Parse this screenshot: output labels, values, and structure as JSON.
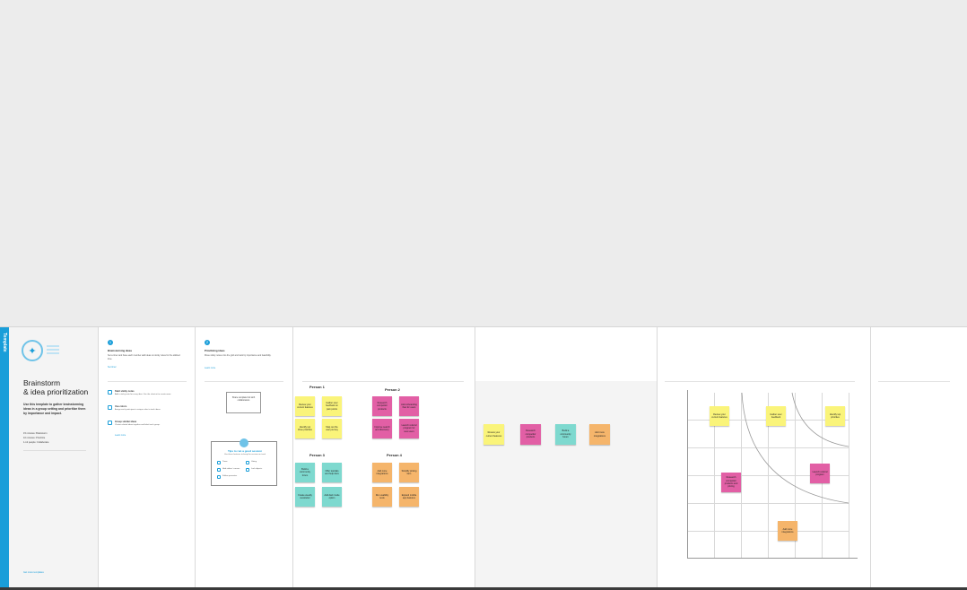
{
  "cover": {
    "accent_label": "Template",
    "logo_icon": "lightbulb-icon",
    "title_line1": "Brainstorm",
    "title_line2": "& idea prioritization",
    "paragraph": "Use this template to gather brainstorming ideas in a group setting and prioritize them by importance and impact.",
    "bullets": [
      "15 minutes: Brainstorm",
      "10 minutes: Prioritize",
      "1-12 people: Collaborate"
    ],
    "footer_link": "Get more templates"
  },
  "step1": {
    "number": "1",
    "heading": "Brainstorming ideas",
    "body": "Set a timer and have each member add ideas on sticky notes for the allotted time.",
    "link": "Set timer",
    "items": [
      {
        "title": "Start sticky notes",
        "text": "Add a sticky note for every idea. Use the shortcut to create more."
      },
      {
        "title": "Use colors",
        "text": "Assign each participant a unique color to track ideas."
      },
      {
        "title": "Group similar ideas",
        "text": "Cluster related ideas together and label each group."
      }
    ],
    "item_link": "Learn more"
  },
  "step2": {
    "number": "2",
    "heading": "Prioritizing ideas",
    "body": "Move sticky notes onto the grid and rank by importance and feasibility.",
    "link": "Learn more",
    "small_box": "Share template link with collaborators",
    "panel_title": "Tips to run a good session",
    "panel_sub": "Use these features to keep the session on track",
    "panel_items": [
      "Timer",
      "Voting",
      "Hide others' cursors",
      "Lock objects",
      "Follow presenter"
    ]
  },
  "brainstorm": {
    "persons": [
      "Person 1",
      "Person 2",
      "Person 3",
      "Person 4"
    ],
    "notes": [
      {
        "text": "Review your current features",
        "color": "#faf47a"
      },
      {
        "text": "Gather user feedback on pain points",
        "color": "#faf47a"
      },
      {
        "text": "Identify top three priorities",
        "color": "#faf47a"
      },
      {
        "text": "Map out the user journey",
        "color": "#faf47a"
      },
      {
        "text": "Research competitor products",
        "color": "#e25fa5"
      },
      {
        "text": "Add onboarding flow for users",
        "color": "#e25fa5"
      },
      {
        "text": "Improve search and discovery",
        "color": "#e25fa5"
      },
      {
        "text": "Launch referral program for new users",
        "color": "#e25fa5"
      },
      {
        "text": "Build a community forum",
        "color": "#7ed9cf"
      },
      {
        "text": "Offer tutorials and help docs",
        "color": "#7ed9cf"
      },
      {
        "text": "Create weekly newsletter",
        "color": "#7ed9cf"
      },
      {
        "text": "Add dark mode option",
        "color": "#7ed9cf"
      },
      {
        "text": "Add more integrations",
        "color": "#f5b56b"
      },
      {
        "text": "Simplify pricing tiers",
        "color": "#f5b56b"
      },
      {
        "text": "Run usability tests",
        "color": "#f5b56b"
      },
      {
        "text": "Expand mobile app features",
        "color": "#f5b56b"
      }
    ]
  },
  "grouped": {
    "notes": [
      {
        "text": "Review your current features",
        "color": "#faf47a"
      },
      {
        "text": "Research competitor products",
        "color": "#e25fa5"
      },
      {
        "text": "Build a community forum",
        "color": "#7ed9cf"
      },
      {
        "text": "Add more integrations",
        "color": "#f5b56b"
      }
    ]
  },
  "matrix": {
    "notes": [
      {
        "text": "Review your current features",
        "color": "#faf47a"
      },
      {
        "text": "Gather user feedback",
        "color": "#faf47a"
      },
      {
        "text": "Identify top priorities",
        "color": "#faf47a"
      },
      {
        "text": "Research competitor products and pricing",
        "color": "#e25fa5"
      },
      {
        "text": "Launch referral program",
        "color": "#e25fa5"
      },
      {
        "text": "Add more integrations",
        "color": "#f5b56b"
      }
    ]
  }
}
